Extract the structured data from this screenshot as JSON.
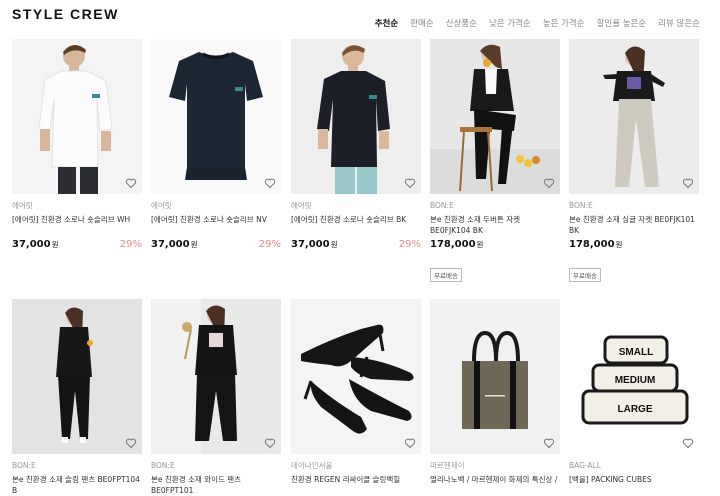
{
  "header": {
    "logo": "STYLE CREW"
  },
  "sort_tabs": [
    {
      "label": "추천순",
      "active": true
    },
    {
      "label": "판매순",
      "active": false
    },
    {
      "label": "신상품순",
      "active": false
    },
    {
      "label": "낮은 가격순",
      "active": false
    },
    {
      "label": "높은 가격순",
      "active": false
    },
    {
      "label": "할인율 높은순",
      "active": false
    },
    {
      "label": "리뷰 많은순",
      "active": false
    }
  ],
  "currency_unit": "원",
  "products": [
    {
      "brand": "에어릿",
      "name": "[에어릿] 친환경 소로나 숏슬리브 WH",
      "price": "37,000",
      "discount": "29%",
      "badge": ""
    },
    {
      "brand": "에어릿",
      "name": "[에어릿] 친환경 소로나 숏슬리브 NV",
      "price": "37,000",
      "discount": "29%",
      "badge": ""
    },
    {
      "brand": "에어릿",
      "name": "[에어릿] 친환경 소로나 숏슬리브 BK",
      "price": "37,000",
      "discount": "29%",
      "badge": ""
    },
    {
      "brand": "BON:E",
      "name": "본e 친환경 소재 두버튼 자켓 BE0FJK104 BK",
      "price": "178,000",
      "discount": "",
      "badge": "무료배송"
    },
    {
      "brand": "BON:E",
      "name": "본e 친환경 소재 싱글 자켓 BE0FJK101 BK",
      "price": "178,000",
      "discount": "",
      "badge": "무료배송"
    },
    {
      "brand": "BON:E",
      "name": "본e 친환경 소재 슬림 팬츠 BE0FPT104 B",
      "price": "",
      "discount": "",
      "badge": ""
    },
    {
      "brand": "BON:E",
      "name": "본e 친환경 소재 와이드 팬츠 BE0FPT101",
      "price": "",
      "discount": "",
      "badge": ""
    },
    {
      "brand": "데이나인서울",
      "name": "친환경 REGEN 리싸이클 슬링백힐",
      "price": "",
      "discount": "",
      "badge": ""
    },
    {
      "brand": "마르헨제이",
      "name": "멀리나노백 / 마르헨제이 화제의 특신상 /",
      "price": "",
      "discount": "",
      "badge": ""
    },
    {
      "brand": "BAG-ALL",
      "name": "[백올] PACKING CUBES",
      "price": "",
      "discount": "",
      "badge": ""
    }
  ],
  "bag_labels": [
    "SMALL",
    "MEDIUM",
    "LARGE"
  ],
  "colors": {
    "discount": "#e08c8c",
    "active_sort": "#111111",
    "inactive_sort": "#8a8a8a"
  }
}
